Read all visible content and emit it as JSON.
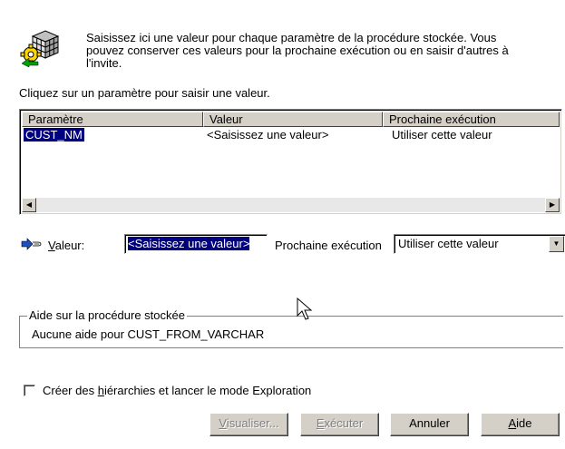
{
  "intro": {
    "line1": "Saisissez ici une valeur pour chaque paramètre de la procédure stockée. Vous",
    "line2": "pouvez conserver ces valeurs pour la prochaine exécution ou en saisir d'autres à",
    "line3": "l'invite."
  },
  "click_hint": "Cliquez sur un paramètre pour saisir une valeur.",
  "params_table": {
    "headers": [
      "Paramètre",
      "Valeur",
      "Prochaine exécution"
    ],
    "rows": [
      {
        "param": "CUST_NM",
        "value": "<Saisissez une valeur>",
        "next": "Utiliser cette valeur"
      }
    ]
  },
  "value_row": {
    "label_key": "V",
    "label_rest": "aleur:",
    "input_value": "<Saisissez une valeur>",
    "next_label": "Prochaine exécution",
    "next_selected": "Utiliser cette valeur"
  },
  "help": {
    "title": "Aide sur la procédure stockée",
    "text": "Aucune aide pour CUST_FROM_VARCHAR"
  },
  "checkbox": {
    "label_before": "Créer des ",
    "label_key": "h",
    "label_after": "iérarchies et lancer le mode Exploration",
    "checked": false
  },
  "buttons": {
    "preview_key": "V",
    "preview_rest": "isualiser...",
    "execute_key": "E",
    "execute_rest": "xécuter",
    "cancel": "Annuler",
    "help_key": "A",
    "help_rest": "ide"
  },
  "colors": {
    "selection": "#000080",
    "face": "#d4d0c8"
  }
}
